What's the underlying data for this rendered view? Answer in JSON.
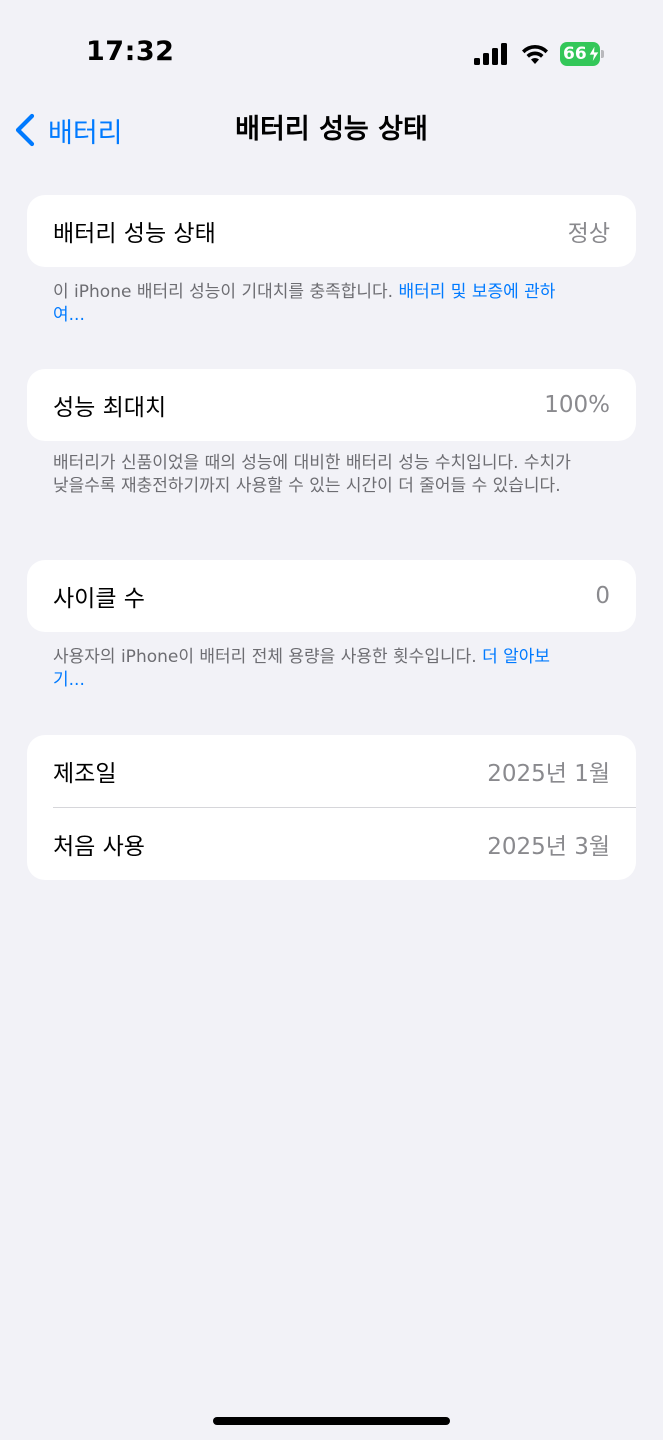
{
  "status_bar": {
    "time": "17:32",
    "battery_level": "66",
    "signal_bars": 4,
    "charging": true,
    "battery_color": "#34c759"
  },
  "nav": {
    "back_label": "배터리",
    "title": "배터리 성능 상태",
    "accent_color": "#007aff"
  },
  "sections": {
    "health": {
      "label": "배터리 성능 상태",
      "value": "정상",
      "footer_text": "이 iPhone 배터리 성능이 기대치를 충족합니다. ",
      "footer_link": "배터리 및 보증에 관하여..."
    },
    "capacity": {
      "label": "성능 최대치",
      "value": "100%",
      "footer_text": "배터리가 신품이었을 때의 성능에 대비한 배터리 성능 수치입니다. 수치가 낮을수록 재충전하기까지 사용할 수 있는 시간이 더 줄어들 수 있습니다."
    },
    "cycles": {
      "label": "사이클 수",
      "value": "0",
      "footer_text": "사용자의 iPhone이 배터리 전체 용량을 사용한 횟수입니다. ",
      "footer_link": "더 알아보기..."
    },
    "dates": {
      "manufactured_label": "제조일",
      "manufactured_value": "2025년 1월",
      "first_use_label": "처음 사용",
      "first_use_value": "2025년 3월"
    }
  }
}
